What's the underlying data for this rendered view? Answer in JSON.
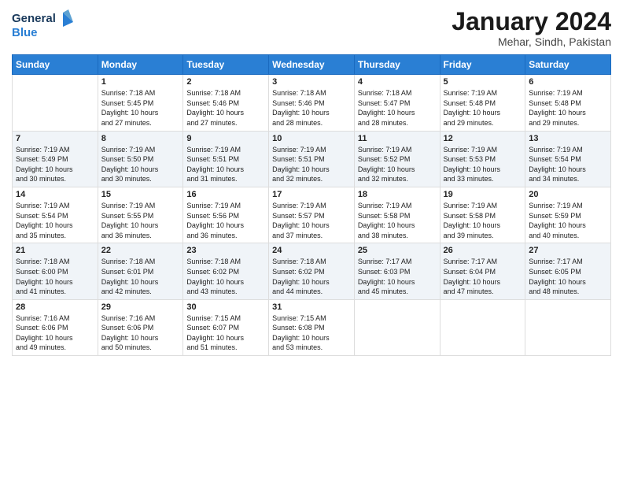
{
  "header": {
    "logo_line1": "General",
    "logo_line2": "Blue",
    "month_title": "January 2024",
    "location": "Mehar, Sindh, Pakistan"
  },
  "days_of_week": [
    "Sunday",
    "Monday",
    "Tuesday",
    "Wednesday",
    "Thursday",
    "Friday",
    "Saturday"
  ],
  "weeks": [
    [
      {
        "day": "",
        "info": ""
      },
      {
        "day": "1",
        "info": "Sunrise: 7:18 AM\nSunset: 5:45 PM\nDaylight: 10 hours\nand 27 minutes."
      },
      {
        "day": "2",
        "info": "Sunrise: 7:18 AM\nSunset: 5:46 PM\nDaylight: 10 hours\nand 27 minutes."
      },
      {
        "day": "3",
        "info": "Sunrise: 7:18 AM\nSunset: 5:46 PM\nDaylight: 10 hours\nand 28 minutes."
      },
      {
        "day": "4",
        "info": "Sunrise: 7:18 AM\nSunset: 5:47 PM\nDaylight: 10 hours\nand 28 minutes."
      },
      {
        "day": "5",
        "info": "Sunrise: 7:19 AM\nSunset: 5:48 PM\nDaylight: 10 hours\nand 29 minutes."
      },
      {
        "day": "6",
        "info": "Sunrise: 7:19 AM\nSunset: 5:48 PM\nDaylight: 10 hours\nand 29 minutes."
      }
    ],
    [
      {
        "day": "7",
        "info": "Sunrise: 7:19 AM\nSunset: 5:49 PM\nDaylight: 10 hours\nand 30 minutes."
      },
      {
        "day": "8",
        "info": "Sunrise: 7:19 AM\nSunset: 5:50 PM\nDaylight: 10 hours\nand 30 minutes."
      },
      {
        "day": "9",
        "info": "Sunrise: 7:19 AM\nSunset: 5:51 PM\nDaylight: 10 hours\nand 31 minutes."
      },
      {
        "day": "10",
        "info": "Sunrise: 7:19 AM\nSunset: 5:51 PM\nDaylight: 10 hours\nand 32 minutes."
      },
      {
        "day": "11",
        "info": "Sunrise: 7:19 AM\nSunset: 5:52 PM\nDaylight: 10 hours\nand 32 minutes."
      },
      {
        "day": "12",
        "info": "Sunrise: 7:19 AM\nSunset: 5:53 PM\nDaylight: 10 hours\nand 33 minutes."
      },
      {
        "day": "13",
        "info": "Sunrise: 7:19 AM\nSunset: 5:54 PM\nDaylight: 10 hours\nand 34 minutes."
      }
    ],
    [
      {
        "day": "14",
        "info": "Sunrise: 7:19 AM\nSunset: 5:54 PM\nDaylight: 10 hours\nand 35 minutes."
      },
      {
        "day": "15",
        "info": "Sunrise: 7:19 AM\nSunset: 5:55 PM\nDaylight: 10 hours\nand 36 minutes."
      },
      {
        "day": "16",
        "info": "Sunrise: 7:19 AM\nSunset: 5:56 PM\nDaylight: 10 hours\nand 36 minutes."
      },
      {
        "day": "17",
        "info": "Sunrise: 7:19 AM\nSunset: 5:57 PM\nDaylight: 10 hours\nand 37 minutes."
      },
      {
        "day": "18",
        "info": "Sunrise: 7:19 AM\nSunset: 5:58 PM\nDaylight: 10 hours\nand 38 minutes."
      },
      {
        "day": "19",
        "info": "Sunrise: 7:19 AM\nSunset: 5:58 PM\nDaylight: 10 hours\nand 39 minutes."
      },
      {
        "day": "20",
        "info": "Sunrise: 7:19 AM\nSunset: 5:59 PM\nDaylight: 10 hours\nand 40 minutes."
      }
    ],
    [
      {
        "day": "21",
        "info": "Sunrise: 7:18 AM\nSunset: 6:00 PM\nDaylight: 10 hours\nand 41 minutes."
      },
      {
        "day": "22",
        "info": "Sunrise: 7:18 AM\nSunset: 6:01 PM\nDaylight: 10 hours\nand 42 minutes."
      },
      {
        "day": "23",
        "info": "Sunrise: 7:18 AM\nSunset: 6:02 PM\nDaylight: 10 hours\nand 43 minutes."
      },
      {
        "day": "24",
        "info": "Sunrise: 7:18 AM\nSunset: 6:02 PM\nDaylight: 10 hours\nand 44 minutes."
      },
      {
        "day": "25",
        "info": "Sunrise: 7:17 AM\nSunset: 6:03 PM\nDaylight: 10 hours\nand 45 minutes."
      },
      {
        "day": "26",
        "info": "Sunrise: 7:17 AM\nSunset: 6:04 PM\nDaylight: 10 hours\nand 47 minutes."
      },
      {
        "day": "27",
        "info": "Sunrise: 7:17 AM\nSunset: 6:05 PM\nDaylight: 10 hours\nand 48 minutes."
      }
    ],
    [
      {
        "day": "28",
        "info": "Sunrise: 7:16 AM\nSunset: 6:06 PM\nDaylight: 10 hours\nand 49 minutes."
      },
      {
        "day": "29",
        "info": "Sunrise: 7:16 AM\nSunset: 6:06 PM\nDaylight: 10 hours\nand 50 minutes."
      },
      {
        "day": "30",
        "info": "Sunrise: 7:15 AM\nSunset: 6:07 PM\nDaylight: 10 hours\nand 51 minutes."
      },
      {
        "day": "31",
        "info": "Sunrise: 7:15 AM\nSunset: 6:08 PM\nDaylight: 10 hours\nand 53 minutes."
      },
      {
        "day": "",
        "info": ""
      },
      {
        "day": "",
        "info": ""
      },
      {
        "day": "",
        "info": ""
      }
    ]
  ]
}
